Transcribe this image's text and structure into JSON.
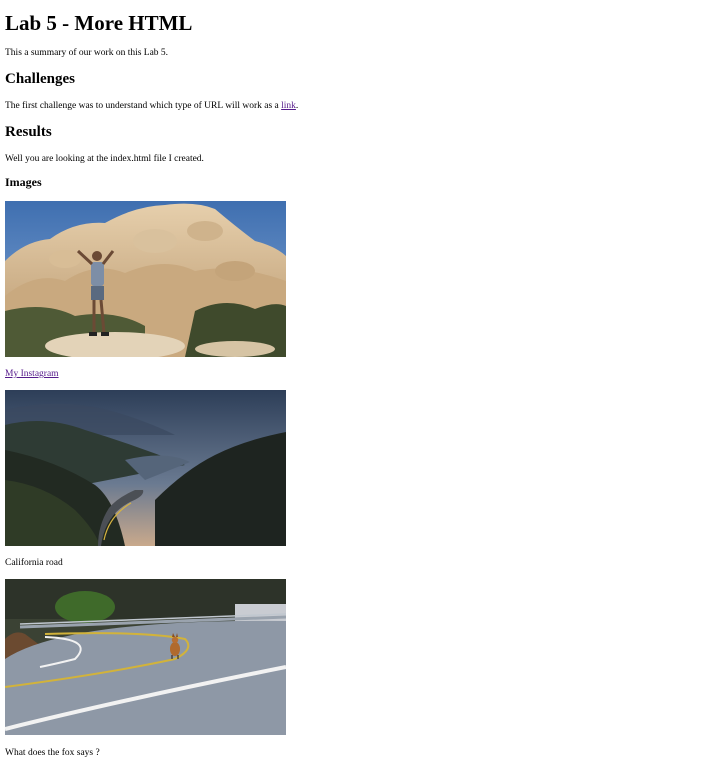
{
  "page": {
    "title": "Lab 5 - More HTML",
    "intro": "This a summary of our work on this Lab 5.",
    "challenges": {
      "heading": "Challenges",
      "text_before": "The first challenge was to understand which type of URL will work as a ",
      "link_label": "link",
      "text_after": "."
    },
    "results": {
      "heading": "Results",
      "text": "Well you are looking at the index.html file I created."
    },
    "images": {
      "heading": "Images",
      "items": [
        {
          "caption": "My Instagram",
          "caption_is_link": true,
          "icon": "desert-rocks-photo"
        },
        {
          "caption": "California road",
          "caption_is_link": false,
          "icon": "mountain-road-photo"
        },
        {
          "caption": "What does the fox says ?",
          "caption_is_link": false,
          "icon": "fox-road-photo"
        }
      ]
    }
  },
  "colors": {
    "link": "#551a8b",
    "text": "#000000",
    "background": "#ffffff"
  }
}
